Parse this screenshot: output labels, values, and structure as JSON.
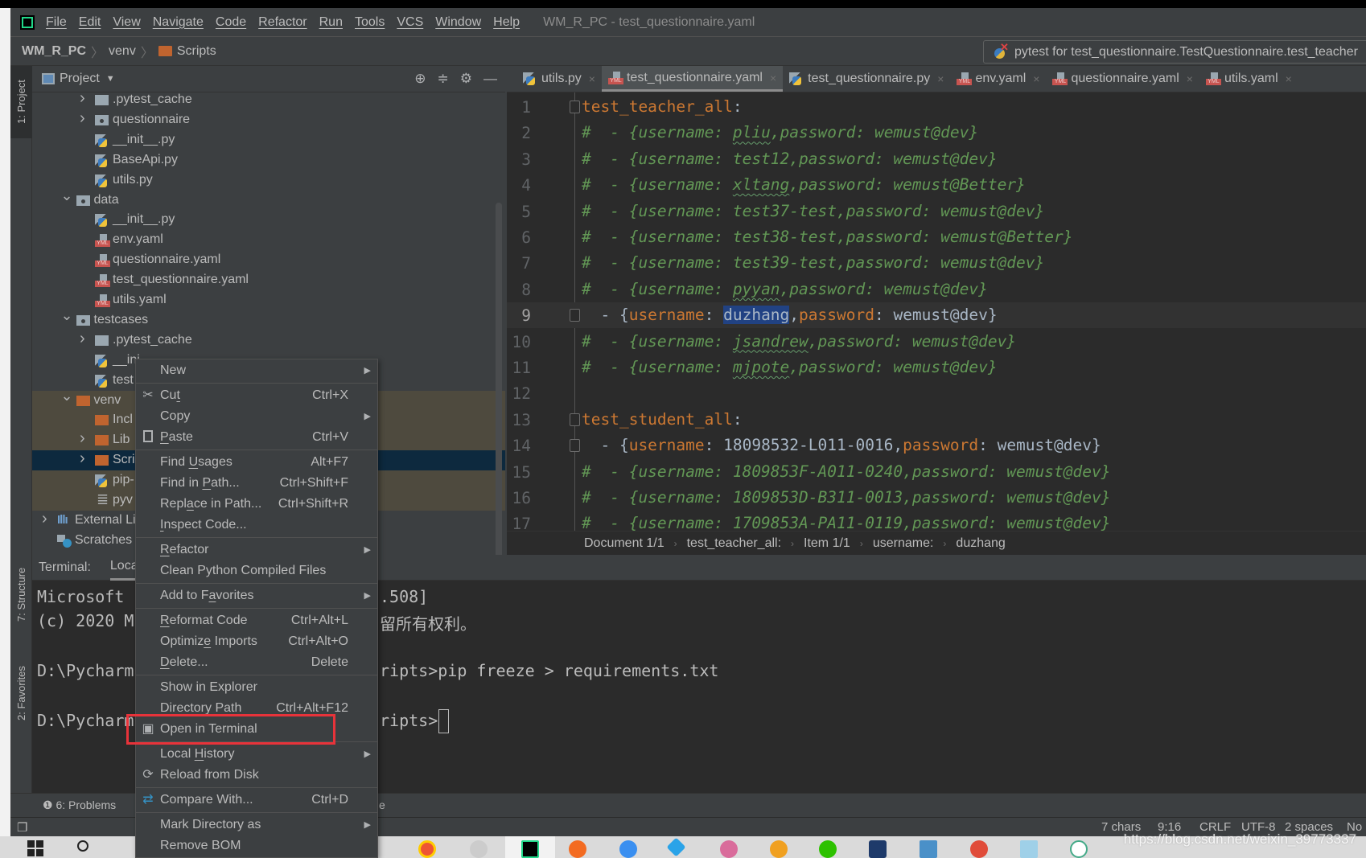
{
  "menubar": {
    "items": [
      "File",
      "Edit",
      "View",
      "Navigate",
      "Code",
      "Refactor",
      "Run",
      "Tools",
      "VCS",
      "Window",
      "Help"
    ],
    "window_title": "WM_R_PC - test_questionnaire.yaml"
  },
  "navbar": {
    "project": "WM_R_PC",
    "crumbs": [
      "venv",
      "Scripts"
    ]
  },
  "run_config": {
    "label": "pytest for test_questionnaire.TestQuestionnaire.test_teacher"
  },
  "left_strip": {
    "project": "1: Project",
    "structure": "7: Structure",
    "favorites": "2: Favorites"
  },
  "project_panel": {
    "title": "Project",
    "tree": [
      {
        "label": ".pytest_cache",
        "level": 2,
        "icon": "folder",
        "arrow": "right",
        "state": "normal"
      },
      {
        "label": "questionnaire",
        "level": 2,
        "icon": "folder-module",
        "arrow": "right",
        "state": "normal"
      },
      {
        "label": "__init__.py",
        "level": 2,
        "icon": "python-file",
        "arrow": "none",
        "state": "normal"
      },
      {
        "label": "BaseApi.py",
        "level": 2,
        "icon": "python-file",
        "arrow": "none",
        "state": "normal"
      },
      {
        "label": "utils.py",
        "level": 2,
        "icon": "python-file",
        "arrow": "none",
        "state": "normal"
      },
      {
        "label": "data",
        "level": 1,
        "icon": "folder-module",
        "arrow": "down",
        "state": "normal"
      },
      {
        "label": "__init__.py",
        "level": 2,
        "icon": "python-file",
        "arrow": "none",
        "state": "normal"
      },
      {
        "label": "env.yaml",
        "level": 2,
        "icon": "yaml-file",
        "arrow": "none",
        "state": "normal"
      },
      {
        "label": "questionnaire.yaml",
        "level": 2,
        "icon": "yaml-file",
        "arrow": "none",
        "state": "normal"
      },
      {
        "label": "test_questionnaire.yaml",
        "level": 2,
        "icon": "yaml-file",
        "arrow": "none",
        "state": "normal"
      },
      {
        "label": "utils.yaml",
        "level": 2,
        "icon": "yaml-file",
        "arrow": "none",
        "state": "normal"
      },
      {
        "label": "testcases",
        "level": 1,
        "icon": "folder-module",
        "arrow": "down",
        "state": "normal"
      },
      {
        "label": ".pytest_cache",
        "level": 2,
        "icon": "folder",
        "arrow": "right",
        "state": "normal"
      },
      {
        "label": "__ini",
        "level": 2,
        "icon": "python-file",
        "arrow": "none",
        "state": "normal"
      },
      {
        "label": "test",
        "level": 2,
        "icon": "python-file",
        "arrow": "none",
        "state": "normal"
      },
      {
        "label": "venv",
        "level": 1,
        "icon": "folder-excluded",
        "arrow": "down",
        "state": "excluded"
      },
      {
        "label": "Incl",
        "level": 2,
        "icon": "folder-excluded",
        "arrow": "none",
        "state": "excluded"
      },
      {
        "label": "Lib",
        "level": 2,
        "icon": "folder-excluded",
        "arrow": "right",
        "state": "excluded"
      },
      {
        "label": "Scri",
        "level": 2,
        "icon": "folder-excluded",
        "arrow": "right",
        "state": "selected"
      },
      {
        "label": "pip-",
        "level": 2,
        "icon": "python-file",
        "arrow": "none",
        "state": "excluded"
      },
      {
        "label": "pyv",
        "level": 2,
        "icon": "text-file",
        "arrow": "none",
        "state": "excluded"
      },
      {
        "label": "External Li",
        "level": 0,
        "icon": "library",
        "arrow": "right",
        "state": "normal"
      },
      {
        "label": "Scratches",
        "level": 0,
        "icon": "scratches",
        "arrow": "none",
        "state": "normal"
      }
    ]
  },
  "editor_tabs": [
    {
      "label": "utils.py",
      "icon": "python-file",
      "active": false
    },
    {
      "label": "test_questionnaire.yaml",
      "icon": "yaml-file",
      "active": true
    },
    {
      "label": "test_questionnaire.py",
      "icon": "python-file",
      "active": false
    },
    {
      "label": "env.yaml",
      "icon": "yaml-file",
      "active": false
    },
    {
      "label": "questionnaire.yaml",
      "icon": "yaml-file",
      "active": false
    },
    {
      "label": "utils.yaml",
      "icon": "yaml-file",
      "active": false
    }
  ],
  "editor": {
    "current_line": 9,
    "lines": [
      {
        "n": "1",
        "fold": true,
        "segs": [
          {
            "text": "test_teacher_all",
            "style": "key"
          },
          {
            "text": ":",
            "style": "plain"
          }
        ]
      },
      {
        "n": "2",
        "segs": [
          {
            "text": "#  - {username: ",
            "style": "comment"
          },
          {
            "text": "pliu",
            "style": "under"
          },
          {
            "text": ",password: wemust@dev}",
            "style": "comment"
          }
        ]
      },
      {
        "n": "3",
        "segs": [
          {
            "text": "#  - {username: test12,password: wemust@dev}",
            "style": "comment"
          }
        ]
      },
      {
        "n": "4",
        "segs": [
          {
            "text": "#  - {username: ",
            "style": "comment"
          },
          {
            "text": "xltang",
            "style": "under"
          },
          {
            "text": ",password: wemust@Better}",
            "style": "comment"
          }
        ]
      },
      {
        "n": "5",
        "segs": [
          {
            "text": "#  - {username: test37-test,password: wemust@dev}",
            "style": "comment"
          }
        ]
      },
      {
        "n": "6",
        "segs": [
          {
            "text": "#  - {username: test38-test,password: wemust@Better}",
            "style": "comment"
          }
        ]
      },
      {
        "n": "7",
        "segs": [
          {
            "text": "#  - {username: test39-test,password: wemust@dev}",
            "style": "comment"
          }
        ]
      },
      {
        "n": "8",
        "segs": [
          {
            "text": "#  - {username: ",
            "style": "comment"
          },
          {
            "text": "pyyan",
            "style": "under"
          },
          {
            "text": ",password: wemust@dev}",
            "style": "comment"
          }
        ]
      },
      {
        "n": "9",
        "fold": true,
        "segs": [
          {
            "text": "  - {",
            "style": "plain"
          },
          {
            "text": "username",
            "style": "key"
          },
          {
            "text": ": ",
            "style": "plain"
          },
          {
            "text": "duzhang",
            "style": "sel"
          },
          {
            "text": ",",
            "style": "plain"
          },
          {
            "text": "password",
            "style": "key"
          },
          {
            "text": ": wemust@dev}",
            "style": "plain"
          }
        ]
      },
      {
        "n": "10",
        "segs": [
          {
            "text": "#  - {username: ",
            "style": "comment"
          },
          {
            "text": "jsandrew",
            "style": "under"
          },
          {
            "text": ",password: wemust@dev}",
            "style": "comment"
          }
        ]
      },
      {
        "n": "11",
        "segs": [
          {
            "text": "#  - {username: ",
            "style": "comment"
          },
          {
            "text": "mjpote",
            "style": "under"
          },
          {
            "text": ",password: wemust@dev}",
            "style": "comment"
          }
        ]
      },
      {
        "n": "12",
        "segs": []
      },
      {
        "n": "13",
        "fold": true,
        "segs": [
          {
            "text": "test_student_all",
            "style": "key"
          },
          {
            "text": ":",
            "style": "plain"
          }
        ]
      },
      {
        "n": "14",
        "fold": true,
        "segs": [
          {
            "text": "  - {",
            "style": "plain"
          },
          {
            "text": "username",
            "style": "key"
          },
          {
            "text": ": 18098532-L011-0016,",
            "style": "plain"
          },
          {
            "text": "password",
            "style": "key"
          },
          {
            "text": ": wemust@dev}",
            "style": "plain"
          }
        ]
      },
      {
        "n": "15",
        "segs": [
          {
            "text": "#  - {username: 1809853F-A011-0240,password: wemust@dev}",
            "style": "comment"
          }
        ]
      },
      {
        "n": "16",
        "segs": [
          {
            "text": "#  - {username: 1809853D-B311-0013,password: wemust@dev}",
            "style": "comment"
          }
        ]
      },
      {
        "n": "17",
        "segs": [
          {
            "text": "#  - {username: 1709853A-PA11-0119,password: wemust@dev}",
            "style": "comment"
          }
        ]
      }
    ],
    "breadcrumbs": [
      "Document 1/1",
      "test_teacher_all:",
      "Item 1/1",
      "username:",
      "duzhang"
    ]
  },
  "terminal": {
    "label": "Terminal:",
    "tab": "Loca",
    "lines": [
      {
        "left": "Microsoft",
        "right": ".508]"
      },
      {
        "left": "(c) 2020 M",
        "right": "留所有权利。"
      },
      {
        "left": "D:\\Pycharm",
        "right": "ripts>pip freeze > requirements.txt"
      },
      {
        "left": "D:\\Pycharm",
        "right": "ripts>"
      }
    ]
  },
  "bottom_bar": {
    "problems": "6: Problems",
    "hidden_tail": "e"
  },
  "status_bar": {
    "chars": "7 chars",
    "position": "9:16",
    "line_sep": "CRLF",
    "encoding": "UTF-8",
    "indent": "2 spaces",
    "tail": "No"
  },
  "watermark": "https://blog.csdn.net/weixin_39773337",
  "context_menu": {
    "highlighted": "Open in Terminal",
    "groups": [
      [
        {
          "label": "New",
          "submenu": true
        }
      ],
      [
        {
          "label": "Cut",
          "shortcut": "Ctrl+X",
          "icon": "scissors-icon",
          "u": 2
        },
        {
          "label": "Copy",
          "submenu": true
        },
        {
          "label": "Paste",
          "shortcut": "Ctrl+V",
          "icon": "clipboard-icon",
          "u": 0
        }
      ],
      [
        {
          "label": "Find Usages",
          "shortcut": "Alt+F7",
          "u": 5
        },
        {
          "label": "Find in Path...",
          "shortcut": "Ctrl+Shift+F",
          "u": 8
        },
        {
          "label": "Replace in Path...",
          "shortcut": "Ctrl+Shift+R",
          "u": 4
        },
        {
          "label": "Inspect Code...",
          "u": 0
        }
      ],
      [
        {
          "label": "Refactor",
          "submenu": true,
          "u": 0
        },
        {
          "label": "Clean Python Compiled Files"
        }
      ],
      [
        {
          "label": "Add to Favorites",
          "submenu": true,
          "u": 8
        }
      ],
      [
        {
          "label": "Reformat Code",
          "shortcut": "Ctrl+Alt+L",
          "u": 0
        },
        {
          "label": "Optimize Imports",
          "shortcut": "Ctrl+Alt+O",
          "u": 7
        },
        {
          "label": "Delete...",
          "shortcut": "Delete",
          "u": 0
        }
      ],
      [
        {
          "label": "Show in Explorer"
        },
        {
          "label": "Directory Path",
          "shortcut": "Ctrl+Alt+F12",
          "u": 10
        },
        {
          "label": "Open in Terminal",
          "icon": "terminal-icon"
        }
      ],
      [
        {
          "label": "Local History",
          "submenu": true,
          "u": 6
        },
        {
          "label": "Reload from Disk",
          "icon": "reload-icon"
        }
      ],
      [
        {
          "label": "Compare With...",
          "shortcut": "Ctrl+D",
          "icon": "compare-icon"
        }
      ],
      [
        {
          "label": "Mark Directory as",
          "submenu": true
        },
        {
          "label": "Remove BOM"
        }
      ]
    ]
  },
  "colors": {
    "keyword": "#cc7832",
    "comment": "#629755",
    "selection": "#214283",
    "highlight_box": "#e8333a",
    "selected_row": "#0d293e",
    "excluded_row": "#4e4a3e"
  }
}
